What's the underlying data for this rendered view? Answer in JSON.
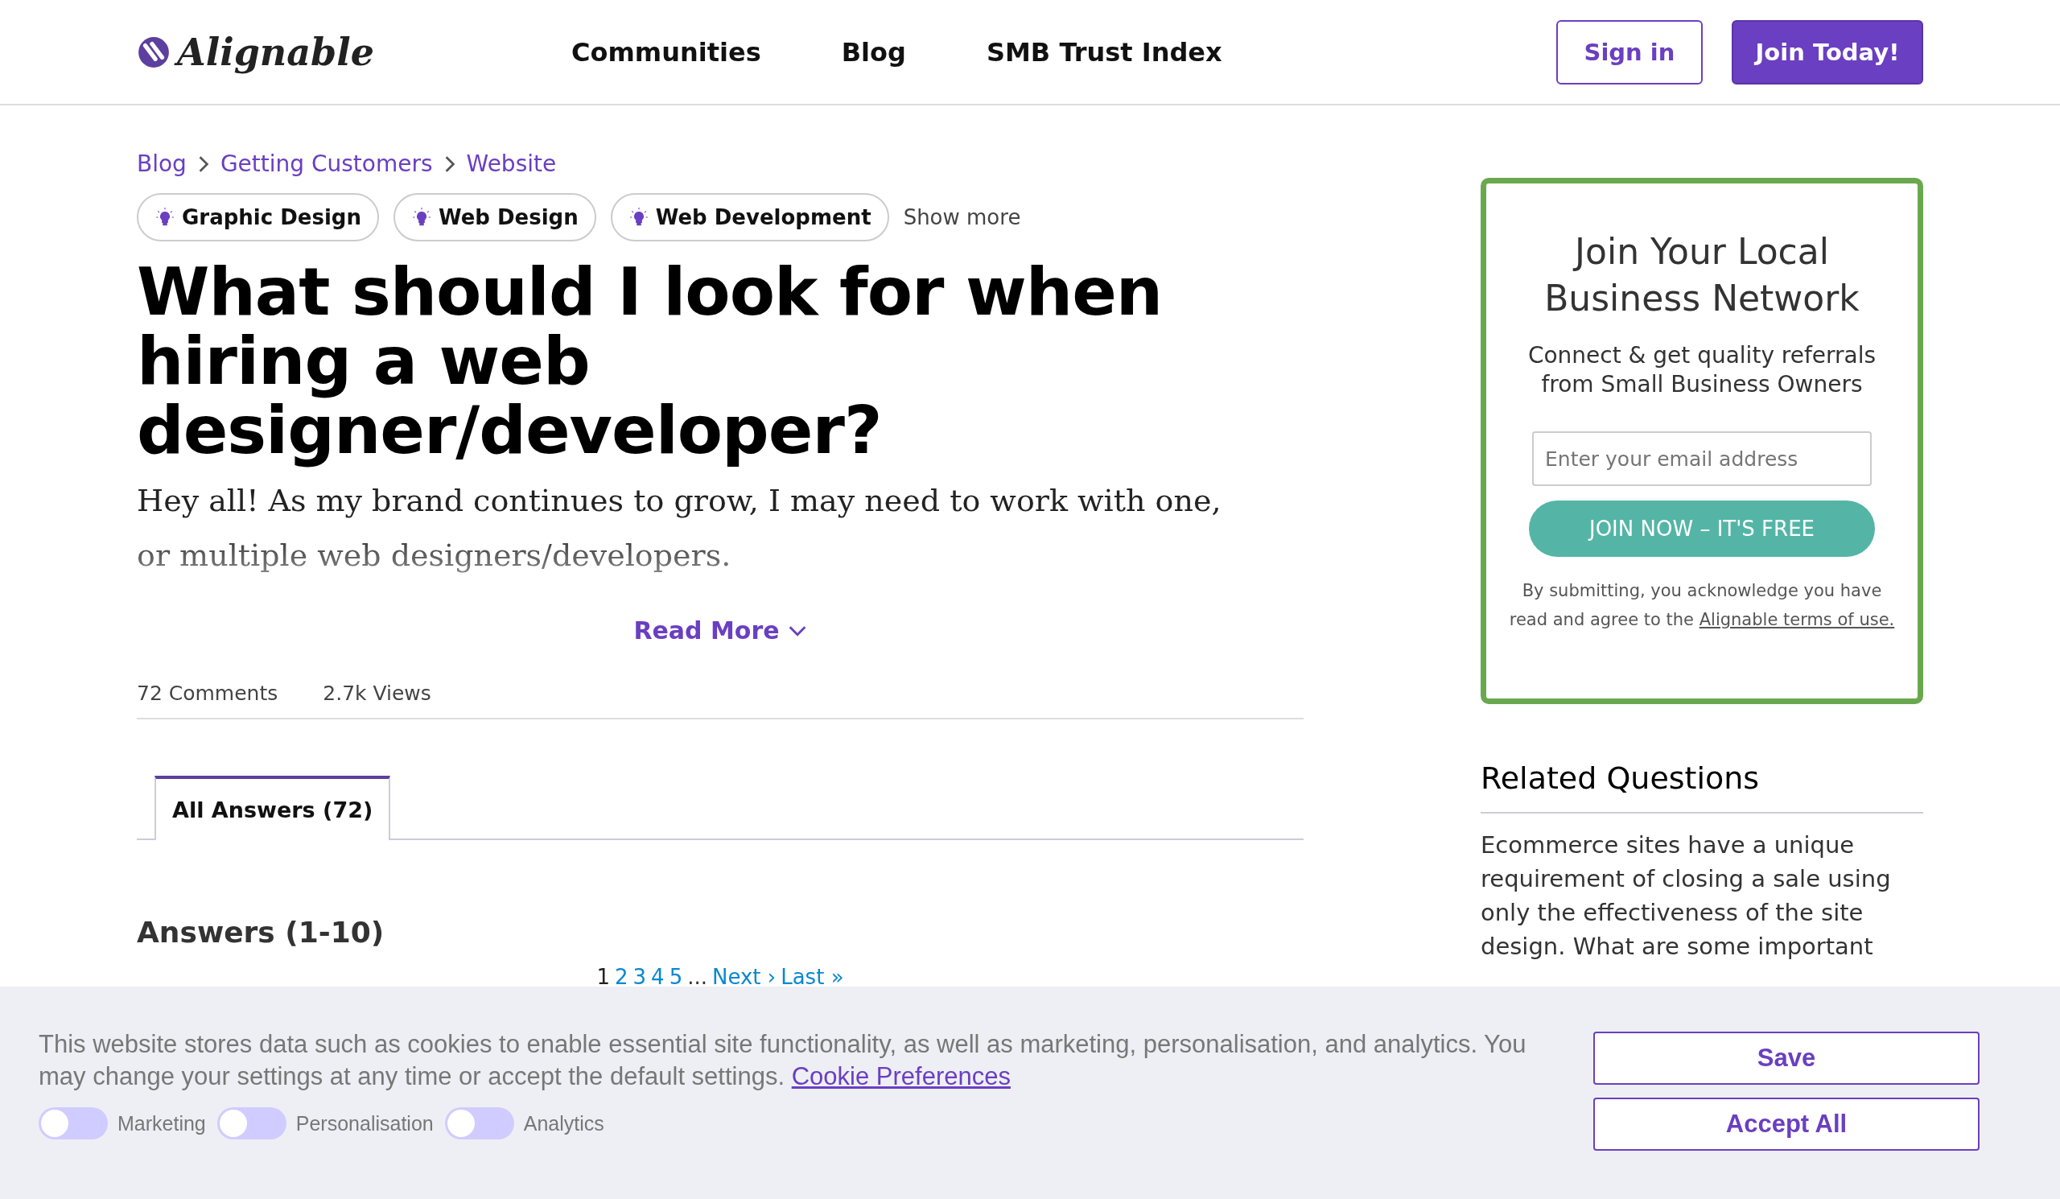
{
  "header": {
    "logo": "Alignable",
    "nav": [
      "Communities",
      "Blog",
      "SMB Trust Index"
    ],
    "sign_in": "Sign in",
    "join": "Join Today!"
  },
  "breadcrumb": [
    "Blog",
    "Getting Customers",
    "Website"
  ],
  "tags": [
    "Graphic Design",
    "Web Design",
    "Web Development"
  ],
  "show_more": "Show more",
  "question": {
    "title": "What should I look for when hiring a web designer/developer?",
    "body": "Hey all! As my brand continues to grow, I may need to work with one, or multiple web designers/developers.",
    "read_more": "Read More"
  },
  "stats": [
    "72 Comments",
    "2.7k Views"
  ],
  "tabs": [
    {
      "label": "All Answers (72)",
      "selected": true
    }
  ],
  "answers_heading": "Answers (1-10)",
  "pagination": [
    {
      "label": "1",
      "selected": true
    },
    {
      "label": "2",
      "selected": false
    },
    {
      "label": "3",
      "selected": false
    },
    {
      "label": "4",
      "selected": false
    },
    {
      "label": "5",
      "selected": false
    }
  ],
  "pagination_more": [
    "...",
    "Next ›",
    "Last »"
  ],
  "signup": {
    "title": "Join Your Local Business Network",
    "subtitle": "Connect & get quality referrals from Small Business Owners",
    "email_placeholder": "Enter your email address",
    "button": "JOIN NOW – IT'S FREE",
    "note": "By submitting, you acknowledge you have read and agree to the ",
    "terms_link": "Alignable terms of use."
  },
  "related": {
    "title": "Related Questions",
    "items": [
      "Ecommerce sites have a unique requirement of closing a sale using only the effectiveness of the site design. What are some important"
    ]
  },
  "cookie_banner": {
    "text": "This website stores data such as cookies to enable essential site functionality, as well as marketing, personalisation, and analytics. You may change your settings at any time or accept the default settings. ",
    "link": "Cookie Preferences",
    "toggles": [
      {
        "label": "Marketing",
        "on": false
      },
      {
        "label": "Personalisation",
        "on": false
      },
      {
        "label": "Analytics",
        "on": false
      }
    ],
    "buttons": [
      "Save",
      "Accept All"
    ]
  }
}
